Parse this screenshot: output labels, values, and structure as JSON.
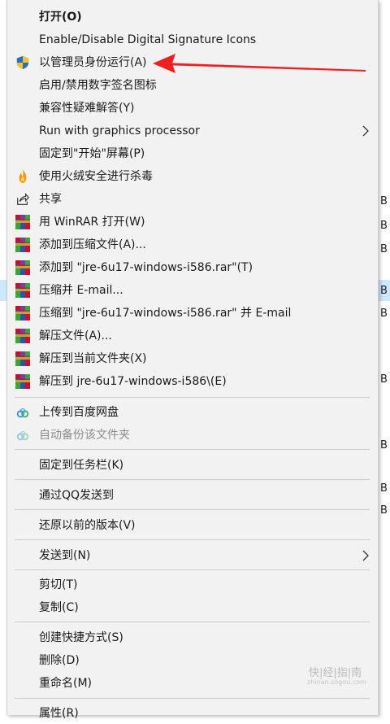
{
  "menu": {
    "items": [
      {
        "label": "打开(O)",
        "bold": true
      },
      {
        "label": "Enable/Disable Digital Signature Icons"
      },
      {
        "label": "以管理员身份运行(A)",
        "icon": "uac-shield-icon"
      },
      {
        "label": "启用/禁用数字签名图标"
      },
      {
        "label": "兼容性疑难解答(Y)"
      },
      {
        "label": "Run with graphics processor",
        "submenu": true
      },
      {
        "label": "固定到\"开始\"屏幕(P)"
      },
      {
        "label": "使用火绒安全进行杀毒",
        "icon": "huorong-flame-icon"
      },
      {
        "label": "共享",
        "icon": "share-icon"
      },
      {
        "label": "用 WinRAR 打开(W)",
        "icon": "winrar-icon"
      },
      {
        "label": "添加到压缩文件(A)...",
        "icon": "winrar-icon"
      },
      {
        "label": "添加到 \"jre-6u17-windows-i586.rar\"(T)",
        "icon": "winrar-icon"
      },
      {
        "label": "压缩并 E-mail...",
        "icon": "winrar-icon"
      },
      {
        "label": "压缩到 \"jre-6u17-windows-i586.rar\" 并 E-mail",
        "icon": "winrar-icon"
      },
      {
        "label": "解压文件(A)...",
        "icon": "winrar-icon"
      },
      {
        "label": "解压到当前文件夹(X)",
        "icon": "winrar-icon"
      },
      {
        "label": "解压到 jre-6u17-windows-i586\\(E)",
        "icon": "winrar-icon"
      },
      {
        "label": "上传到百度网盘",
        "icon": "baidu-cloud-icon"
      },
      {
        "label": "自动备份该文件夹",
        "icon": "baidu-cloud-icon",
        "disabled": true
      },
      {
        "label": "固定到任务栏(K)"
      },
      {
        "label": "通过QQ发送到"
      },
      {
        "label": "还原以前的版本(V)"
      },
      {
        "label": "发送到(N)",
        "submenu": true
      },
      {
        "label": "剪切(T)"
      },
      {
        "label": "复制(C)"
      },
      {
        "label": "创建快捷方式(S)"
      },
      {
        "label": "删除(D)"
      },
      {
        "label": "重命名(M)"
      },
      {
        "label": "属性(R)"
      }
    ]
  },
  "background_fragments": [
    "B",
    "B",
    "B",
    "B",
    "B",
    "B",
    "B",
    "B",
    "B"
  ],
  "watermark": {
    "text": "快|经|指|南",
    "sub": "zhinan.sogou.com"
  },
  "colors": {
    "menu_bg": "#f2f2f2",
    "annotation_arrow": "#f02020",
    "selection": "#cce8ff"
  }
}
